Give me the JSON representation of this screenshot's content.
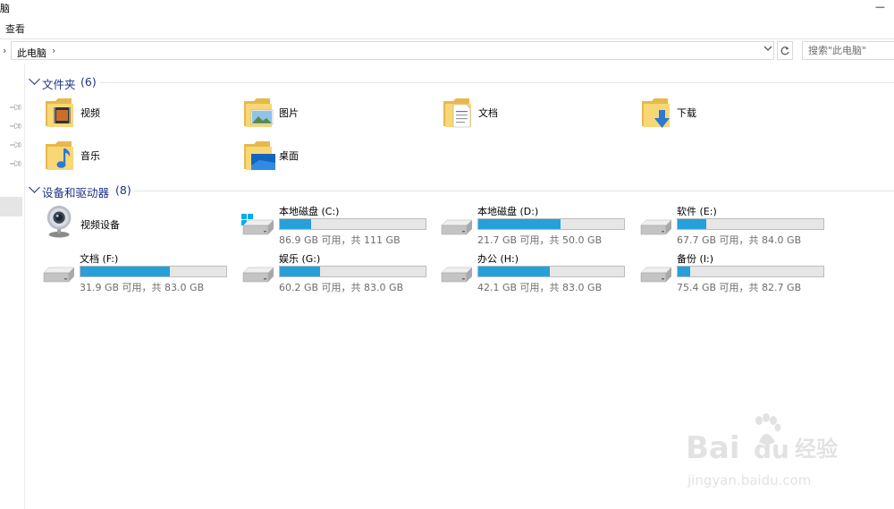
{
  "window": {
    "title_fragment": "脑",
    "minimize_symbol": "—"
  },
  "ribbon": {
    "view_tab": "查看"
  },
  "address": {
    "back_symbol": "›",
    "crumb": "此电脑",
    "crumb_sep": "›",
    "search_placeholder": "搜索\"此电脑\""
  },
  "groups": {
    "folders": {
      "title": "文件夹",
      "count": "(6)"
    },
    "drives": {
      "title": "设备和驱动器",
      "count": "(8)"
    }
  },
  "folders": [
    {
      "name": "视频",
      "icon": "video-folder-icon"
    },
    {
      "name": "图片",
      "icon": "pictures-folder-icon"
    },
    {
      "name": "文档",
      "icon": "documents-folder-icon"
    },
    {
      "name": "下载",
      "icon": "downloads-folder-icon"
    },
    {
      "name": "音乐",
      "icon": "music-folder-icon"
    },
    {
      "name": "桌面",
      "icon": "desktop-folder-icon"
    }
  ],
  "devices": {
    "webcam": {
      "name": "视频设备",
      "icon": "webcam-icon"
    },
    "drives": [
      {
        "name": "本地磁盘 (C:)",
        "free": "86.9 GB 可用，共 111 GB",
        "used_fraction": 0.217,
        "system": true
      },
      {
        "name": "本地磁盘 (D:)",
        "free": "21.7 GB 可用，共 50.0 GB",
        "used_fraction": 0.566,
        "system": false
      },
      {
        "name": "软件 (E:)",
        "free": "67.7 GB 可用，共 84.0 GB",
        "used_fraction": 0.194,
        "system": false
      },
      {
        "name": "文档 (F:)",
        "free": "31.9 GB 可用，共 83.0 GB",
        "used_fraction": 0.616,
        "system": false
      },
      {
        "name": "娱乐 (G:)",
        "free": "60.2 GB 可用，共 83.0 GB",
        "used_fraction": 0.275,
        "system": false
      },
      {
        "name": "办公 (H:)",
        "free": "42.1 GB 可用，共 83.0 GB",
        "used_fraction": 0.493,
        "system": false
      },
      {
        "name": "备份 (I:)",
        "free": "75.4 GB 可用，共 82.7 GB",
        "used_fraction": 0.088,
        "system": false
      }
    ]
  },
  "colors": {
    "accent": "#1e3287",
    "bar_fill": "#26a0da",
    "bar_bg": "#e6e6e6",
    "folder_yellow": "#f8d775"
  },
  "watermark": {
    "brand": "Bai du 经验",
    "url": "jingyan.baidu.com"
  }
}
